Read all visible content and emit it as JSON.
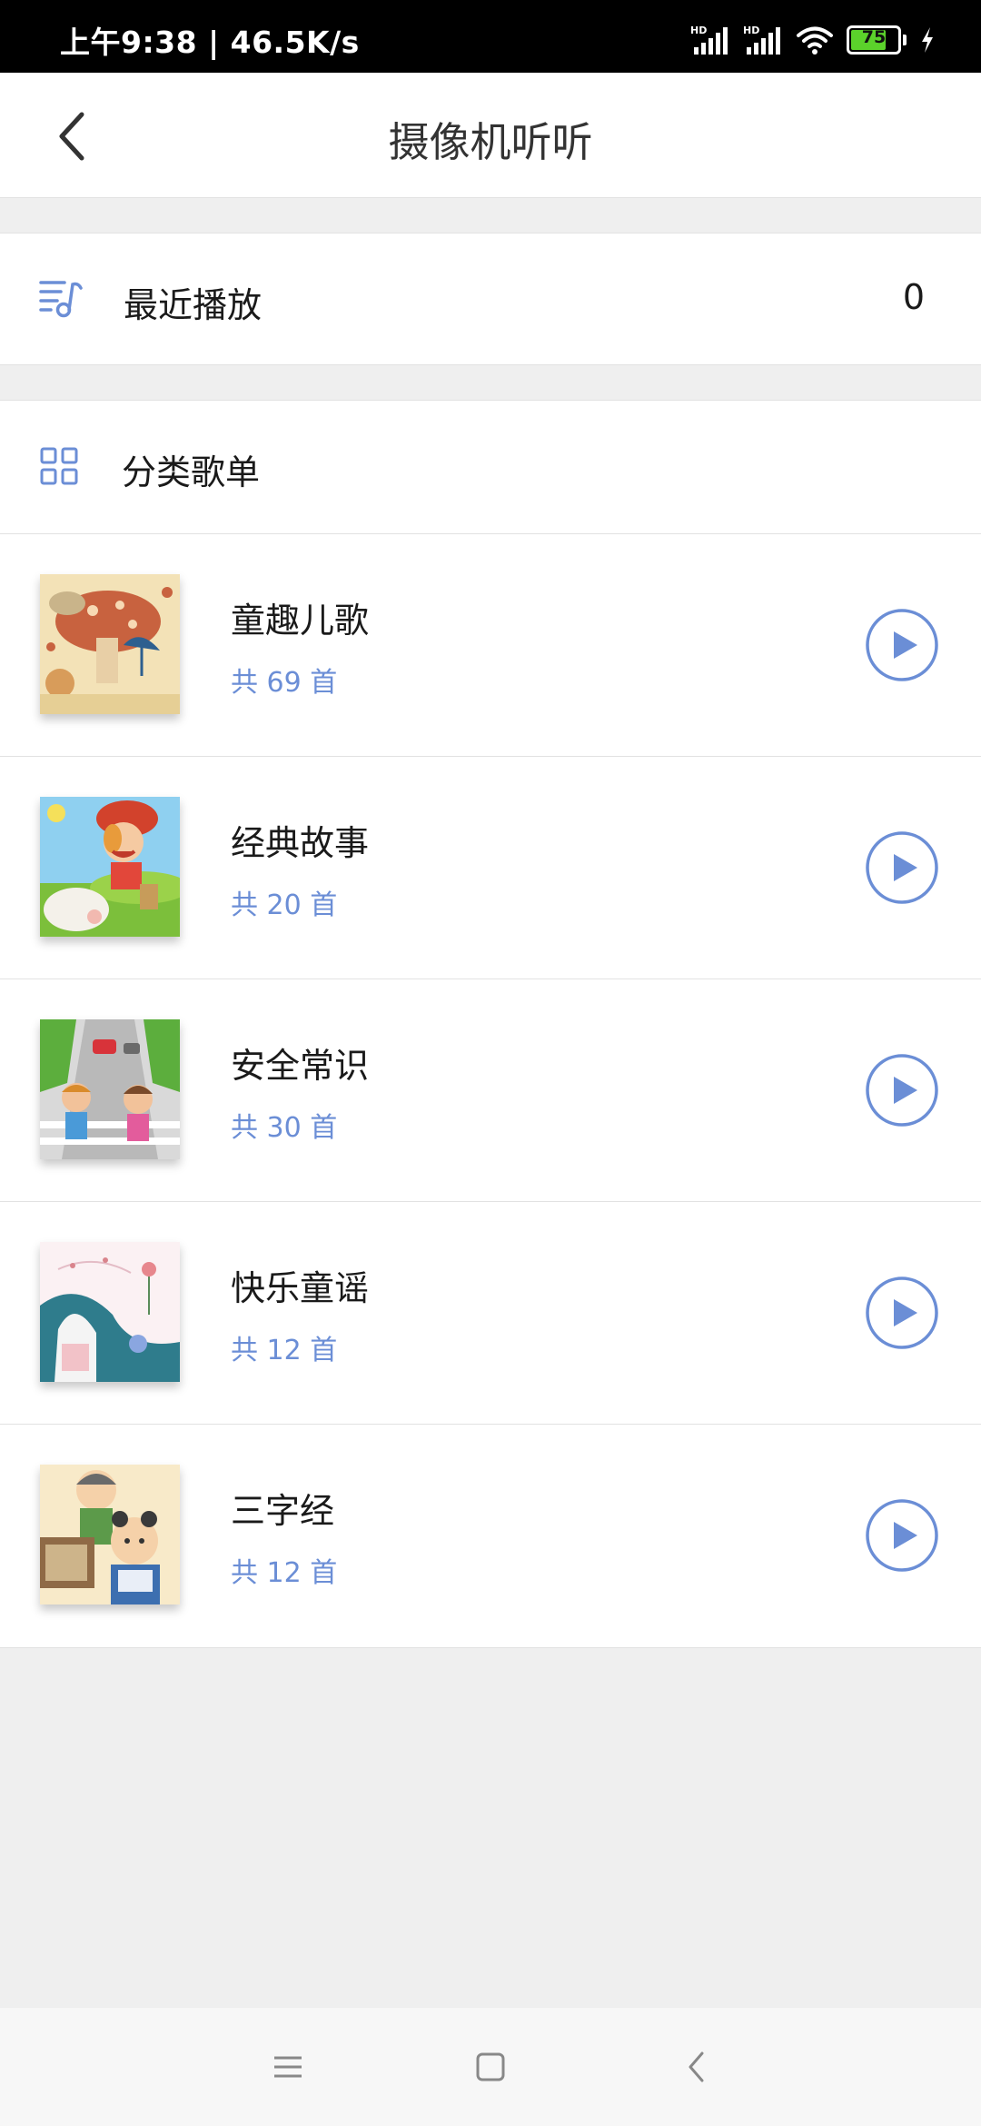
{
  "status_bar": {
    "time": "上午9:38 | 46.5K/s",
    "battery_level": "75",
    "icons": [
      "hd-signal-icon",
      "hd-signal-icon",
      "wifi-icon",
      "battery-icon",
      "charging-icon"
    ]
  },
  "header": {
    "title": "摄像机听听",
    "back_icon": "chevron-left-icon"
  },
  "recent": {
    "label": "最近播放",
    "count": "0",
    "icon": "music-list-icon"
  },
  "categories": {
    "title": "分类歌单",
    "icon": "grid-icon",
    "items": [
      {
        "title": "童趣儿歌",
        "count": "共 69 首"
      },
      {
        "title": "经典故事",
        "count": "共 20 首"
      },
      {
        "title": "安全常识",
        "count": "共 30 首"
      },
      {
        "title": "快乐童谣",
        "count": "共 12 首"
      },
      {
        "title": "三字经",
        "count": "共 12 首"
      }
    ]
  },
  "nav_bar": {
    "icons": [
      "menu-icon",
      "home-icon",
      "back-icon"
    ]
  },
  "colors": {
    "accent": "#6b8ed6",
    "status_bar": "#000000",
    "background": "#efefef",
    "battery": "#5bd22b"
  }
}
